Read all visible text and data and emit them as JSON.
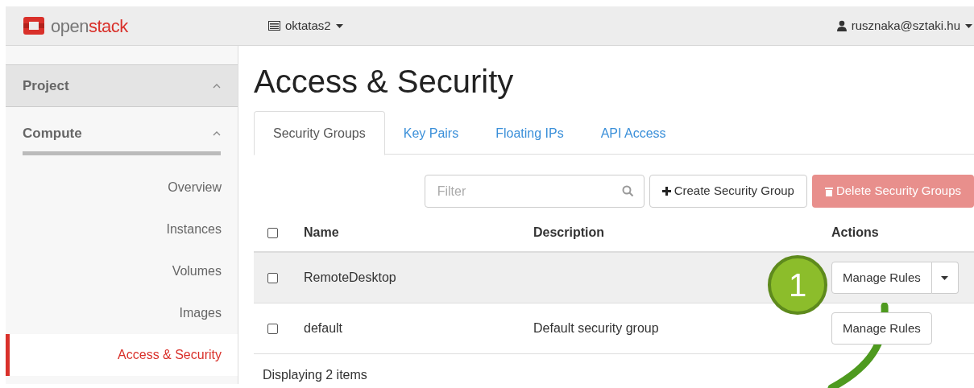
{
  "topbar": {
    "logo_prefix": "open",
    "logo_suffix": "stack",
    "project": "oktatas2",
    "user": "rusznaka@sztaki.hu"
  },
  "sidebar": {
    "sections": [
      {
        "label": "Project",
        "expanded": true,
        "kind": "panel"
      },
      {
        "label": "Compute",
        "expanded": true,
        "kind": "group"
      }
    ],
    "items": [
      {
        "label": "Overview",
        "selected": false
      },
      {
        "label": "Instances",
        "selected": false
      },
      {
        "label": "Volumes",
        "selected": false
      },
      {
        "label": "Images",
        "selected": false
      },
      {
        "label": "Access & Security",
        "selected": true
      }
    ]
  },
  "page_title": "Access & Security",
  "tabs": [
    {
      "label": "Security Groups",
      "selected": true
    },
    {
      "label": "Key Pairs",
      "selected": false
    },
    {
      "label": "Floating IPs",
      "selected": false
    },
    {
      "label": "API Access",
      "selected": false
    }
  ],
  "toolbar": {
    "filter_placeholder": "Filter",
    "create_button": "Create Security Group",
    "delete_button": {
      "label": "Delete Security Groups",
      "disabled": true
    }
  },
  "table": {
    "select_all_checked": false,
    "columns": [
      "Name",
      "Description",
      "Actions"
    ],
    "rows": [
      {
        "name": "RemoteDesktop",
        "description": "",
        "action": "Manage Rules",
        "has_dropdown": true,
        "checked": false,
        "highlighted": true
      },
      {
        "name": "default",
        "description": "Default security group",
        "action": "Manage Rules",
        "has_dropdown": false,
        "checked": false,
        "highlighted": false
      }
    ],
    "footer": "Displaying 2 items"
  },
  "callout": {
    "number": "1"
  }
}
